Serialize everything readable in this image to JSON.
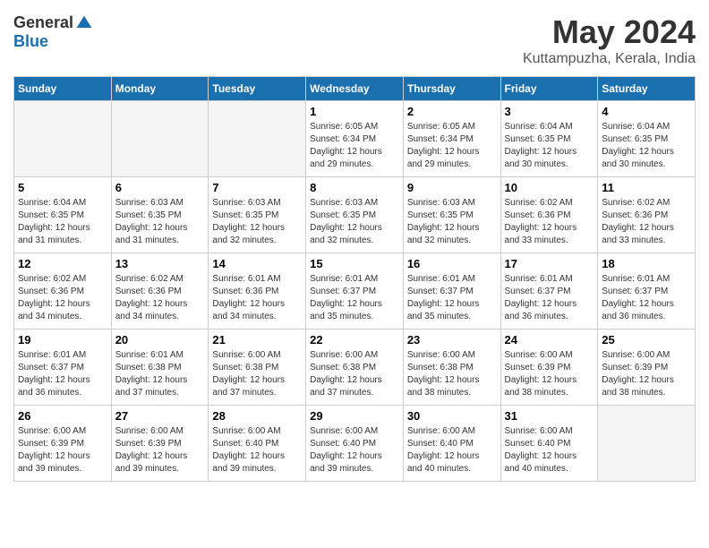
{
  "header": {
    "logo_general": "General",
    "logo_blue": "Blue",
    "month_year": "May 2024",
    "location": "Kuttampuzha, Kerala, India"
  },
  "weekdays": [
    "Sunday",
    "Monday",
    "Tuesday",
    "Wednesday",
    "Thursday",
    "Friday",
    "Saturday"
  ],
  "weeks": [
    [
      {
        "day": "",
        "sunrise": "",
        "sunset": "",
        "daylight": ""
      },
      {
        "day": "",
        "sunrise": "",
        "sunset": "",
        "daylight": ""
      },
      {
        "day": "",
        "sunrise": "",
        "sunset": "",
        "daylight": ""
      },
      {
        "day": "1",
        "sunrise": "Sunrise: 6:05 AM",
        "sunset": "Sunset: 6:34 PM",
        "daylight": "Daylight: 12 hours and 29 minutes."
      },
      {
        "day": "2",
        "sunrise": "Sunrise: 6:05 AM",
        "sunset": "Sunset: 6:34 PM",
        "daylight": "Daylight: 12 hours and 29 minutes."
      },
      {
        "day": "3",
        "sunrise": "Sunrise: 6:04 AM",
        "sunset": "Sunset: 6:35 PM",
        "daylight": "Daylight: 12 hours and 30 minutes."
      },
      {
        "day": "4",
        "sunrise": "Sunrise: 6:04 AM",
        "sunset": "Sunset: 6:35 PM",
        "daylight": "Daylight: 12 hours and 30 minutes."
      }
    ],
    [
      {
        "day": "5",
        "sunrise": "Sunrise: 6:04 AM",
        "sunset": "Sunset: 6:35 PM",
        "daylight": "Daylight: 12 hours and 31 minutes."
      },
      {
        "day": "6",
        "sunrise": "Sunrise: 6:03 AM",
        "sunset": "Sunset: 6:35 PM",
        "daylight": "Daylight: 12 hours and 31 minutes."
      },
      {
        "day": "7",
        "sunrise": "Sunrise: 6:03 AM",
        "sunset": "Sunset: 6:35 PM",
        "daylight": "Daylight: 12 hours and 32 minutes."
      },
      {
        "day": "8",
        "sunrise": "Sunrise: 6:03 AM",
        "sunset": "Sunset: 6:35 PM",
        "daylight": "Daylight: 12 hours and 32 minutes."
      },
      {
        "day": "9",
        "sunrise": "Sunrise: 6:03 AM",
        "sunset": "Sunset: 6:35 PM",
        "daylight": "Daylight: 12 hours and 32 minutes."
      },
      {
        "day": "10",
        "sunrise": "Sunrise: 6:02 AM",
        "sunset": "Sunset: 6:36 PM",
        "daylight": "Daylight: 12 hours and 33 minutes."
      },
      {
        "day": "11",
        "sunrise": "Sunrise: 6:02 AM",
        "sunset": "Sunset: 6:36 PM",
        "daylight": "Daylight: 12 hours and 33 minutes."
      }
    ],
    [
      {
        "day": "12",
        "sunrise": "Sunrise: 6:02 AM",
        "sunset": "Sunset: 6:36 PM",
        "daylight": "Daylight: 12 hours and 34 minutes."
      },
      {
        "day": "13",
        "sunrise": "Sunrise: 6:02 AM",
        "sunset": "Sunset: 6:36 PM",
        "daylight": "Daylight: 12 hours and 34 minutes."
      },
      {
        "day": "14",
        "sunrise": "Sunrise: 6:01 AM",
        "sunset": "Sunset: 6:36 PM",
        "daylight": "Daylight: 12 hours and 34 minutes."
      },
      {
        "day": "15",
        "sunrise": "Sunrise: 6:01 AM",
        "sunset": "Sunset: 6:37 PM",
        "daylight": "Daylight: 12 hours and 35 minutes."
      },
      {
        "day": "16",
        "sunrise": "Sunrise: 6:01 AM",
        "sunset": "Sunset: 6:37 PM",
        "daylight": "Daylight: 12 hours and 35 minutes."
      },
      {
        "day": "17",
        "sunrise": "Sunrise: 6:01 AM",
        "sunset": "Sunset: 6:37 PM",
        "daylight": "Daylight: 12 hours and 36 minutes."
      },
      {
        "day": "18",
        "sunrise": "Sunrise: 6:01 AM",
        "sunset": "Sunset: 6:37 PM",
        "daylight": "Daylight: 12 hours and 36 minutes."
      }
    ],
    [
      {
        "day": "19",
        "sunrise": "Sunrise: 6:01 AM",
        "sunset": "Sunset: 6:37 PM",
        "daylight": "Daylight: 12 hours and 36 minutes."
      },
      {
        "day": "20",
        "sunrise": "Sunrise: 6:01 AM",
        "sunset": "Sunset: 6:38 PM",
        "daylight": "Daylight: 12 hours and 37 minutes."
      },
      {
        "day": "21",
        "sunrise": "Sunrise: 6:00 AM",
        "sunset": "Sunset: 6:38 PM",
        "daylight": "Daylight: 12 hours and 37 minutes."
      },
      {
        "day": "22",
        "sunrise": "Sunrise: 6:00 AM",
        "sunset": "Sunset: 6:38 PM",
        "daylight": "Daylight: 12 hours and 37 minutes."
      },
      {
        "day": "23",
        "sunrise": "Sunrise: 6:00 AM",
        "sunset": "Sunset: 6:38 PM",
        "daylight": "Daylight: 12 hours and 38 minutes."
      },
      {
        "day": "24",
        "sunrise": "Sunrise: 6:00 AM",
        "sunset": "Sunset: 6:39 PM",
        "daylight": "Daylight: 12 hours and 38 minutes."
      },
      {
        "day": "25",
        "sunrise": "Sunrise: 6:00 AM",
        "sunset": "Sunset: 6:39 PM",
        "daylight": "Daylight: 12 hours and 38 minutes."
      }
    ],
    [
      {
        "day": "26",
        "sunrise": "Sunrise: 6:00 AM",
        "sunset": "Sunset: 6:39 PM",
        "daylight": "Daylight: 12 hours and 39 minutes."
      },
      {
        "day": "27",
        "sunrise": "Sunrise: 6:00 AM",
        "sunset": "Sunset: 6:39 PM",
        "daylight": "Daylight: 12 hours and 39 minutes."
      },
      {
        "day": "28",
        "sunrise": "Sunrise: 6:00 AM",
        "sunset": "Sunset: 6:40 PM",
        "daylight": "Daylight: 12 hours and 39 minutes."
      },
      {
        "day": "29",
        "sunrise": "Sunrise: 6:00 AM",
        "sunset": "Sunset: 6:40 PM",
        "daylight": "Daylight: 12 hours and 39 minutes."
      },
      {
        "day": "30",
        "sunrise": "Sunrise: 6:00 AM",
        "sunset": "Sunset: 6:40 PM",
        "daylight": "Daylight: 12 hours and 40 minutes."
      },
      {
        "day": "31",
        "sunrise": "Sunrise: 6:00 AM",
        "sunset": "Sunset: 6:40 PM",
        "daylight": "Daylight: 12 hours and 40 minutes."
      },
      {
        "day": "",
        "sunrise": "",
        "sunset": "",
        "daylight": ""
      }
    ]
  ]
}
